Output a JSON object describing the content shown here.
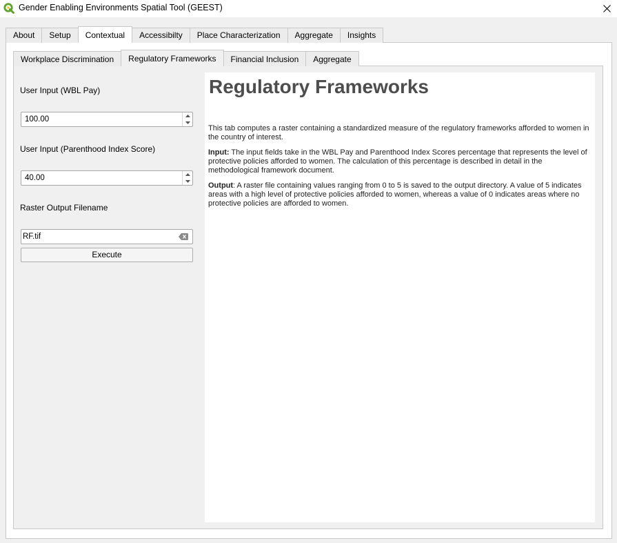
{
  "window": {
    "title": "Gender Enabling Environments Spatial Tool (GEEST)",
    "icon": "qgis-logo-icon",
    "close_icon": "close-icon"
  },
  "main_tabs": [
    {
      "label": "About"
    },
    {
      "label": "Setup"
    },
    {
      "label": "Contextual",
      "active": true
    },
    {
      "label": "Accessibilty"
    },
    {
      "label": "Place Characterization"
    },
    {
      "label": "Aggregate"
    },
    {
      "label": "Insights"
    }
  ],
  "sub_tabs": [
    {
      "label": "Workplace Discrimination"
    },
    {
      "label": "Regulatory Frameworks",
      "active": true
    },
    {
      "label": "Financial Inclusion"
    },
    {
      "label": "Aggregate"
    }
  ],
  "form": {
    "wbl_pay_label": "User Input (WBL Pay)",
    "wbl_pay_value": "100.00",
    "parenthood_label": "User Input (Parenthood Index Score)",
    "parenthood_value": "40.00",
    "raster_label": "Raster Output Filename",
    "raster_value": "RF.tif",
    "execute_label": "Execute"
  },
  "help": {
    "title": "Regulatory Frameworks",
    "intro": "This tab computes a raster containing a standardized measure of the regulatory frameworks afforded to women in the country of interest.",
    "input_heading": "Input:",
    "input_text": " The input fields take in the WBL Pay and Parenthood Index Scores percentage that represents the level of protective policies afforded to women. The calculation of this percentage is described in detail in the methodological framework document.",
    "output_heading": "Output",
    "output_text": ": A raster file containing values ranging from 0 to 5 is saved to the output directory. A value of 5 indicates areas with a high level of protective policies afforded to women, whereas a value of 0 indicates areas where no protective policies are afforded to women."
  },
  "colors": {
    "accent_green": "#5fa32a",
    "title_gray": "#4d4d4d"
  }
}
